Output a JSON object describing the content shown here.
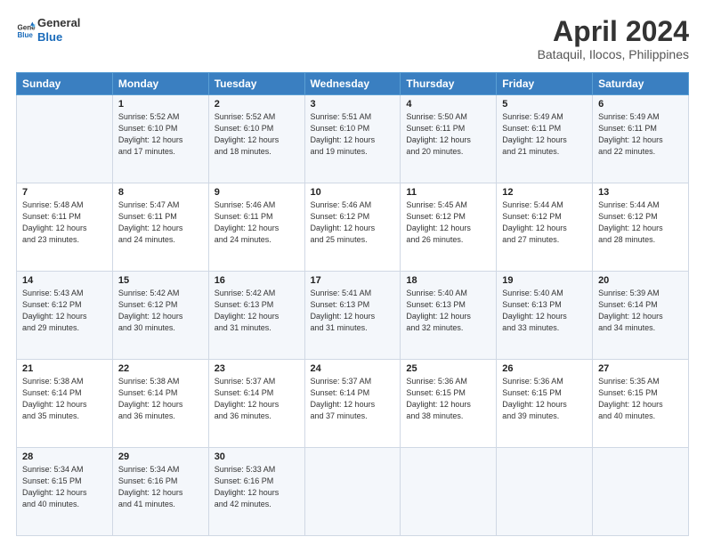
{
  "header": {
    "logo_line1": "General",
    "logo_line2": "Blue",
    "title": "April 2024",
    "subtitle": "Bataquil, Ilocos, Philippines"
  },
  "columns": [
    "Sunday",
    "Monday",
    "Tuesday",
    "Wednesday",
    "Thursday",
    "Friday",
    "Saturday"
  ],
  "rows": [
    [
      {
        "day": "",
        "info": ""
      },
      {
        "day": "1",
        "info": "Sunrise: 5:52 AM\nSunset: 6:10 PM\nDaylight: 12 hours\nand 17 minutes."
      },
      {
        "day": "2",
        "info": "Sunrise: 5:52 AM\nSunset: 6:10 PM\nDaylight: 12 hours\nand 18 minutes."
      },
      {
        "day": "3",
        "info": "Sunrise: 5:51 AM\nSunset: 6:10 PM\nDaylight: 12 hours\nand 19 minutes."
      },
      {
        "day": "4",
        "info": "Sunrise: 5:50 AM\nSunset: 6:11 PM\nDaylight: 12 hours\nand 20 minutes."
      },
      {
        "day": "5",
        "info": "Sunrise: 5:49 AM\nSunset: 6:11 PM\nDaylight: 12 hours\nand 21 minutes."
      },
      {
        "day": "6",
        "info": "Sunrise: 5:49 AM\nSunset: 6:11 PM\nDaylight: 12 hours\nand 22 minutes."
      }
    ],
    [
      {
        "day": "7",
        "info": "Sunrise: 5:48 AM\nSunset: 6:11 PM\nDaylight: 12 hours\nand 23 minutes."
      },
      {
        "day": "8",
        "info": "Sunrise: 5:47 AM\nSunset: 6:11 PM\nDaylight: 12 hours\nand 24 minutes."
      },
      {
        "day": "9",
        "info": "Sunrise: 5:46 AM\nSunset: 6:11 PM\nDaylight: 12 hours\nand 24 minutes."
      },
      {
        "day": "10",
        "info": "Sunrise: 5:46 AM\nSunset: 6:12 PM\nDaylight: 12 hours\nand 25 minutes."
      },
      {
        "day": "11",
        "info": "Sunrise: 5:45 AM\nSunset: 6:12 PM\nDaylight: 12 hours\nand 26 minutes."
      },
      {
        "day": "12",
        "info": "Sunrise: 5:44 AM\nSunset: 6:12 PM\nDaylight: 12 hours\nand 27 minutes."
      },
      {
        "day": "13",
        "info": "Sunrise: 5:44 AM\nSunset: 6:12 PM\nDaylight: 12 hours\nand 28 minutes."
      }
    ],
    [
      {
        "day": "14",
        "info": "Sunrise: 5:43 AM\nSunset: 6:12 PM\nDaylight: 12 hours\nand 29 minutes."
      },
      {
        "day": "15",
        "info": "Sunrise: 5:42 AM\nSunset: 6:12 PM\nDaylight: 12 hours\nand 30 minutes."
      },
      {
        "day": "16",
        "info": "Sunrise: 5:42 AM\nSunset: 6:13 PM\nDaylight: 12 hours\nand 31 minutes."
      },
      {
        "day": "17",
        "info": "Sunrise: 5:41 AM\nSunset: 6:13 PM\nDaylight: 12 hours\nand 31 minutes."
      },
      {
        "day": "18",
        "info": "Sunrise: 5:40 AM\nSunset: 6:13 PM\nDaylight: 12 hours\nand 32 minutes."
      },
      {
        "day": "19",
        "info": "Sunrise: 5:40 AM\nSunset: 6:13 PM\nDaylight: 12 hours\nand 33 minutes."
      },
      {
        "day": "20",
        "info": "Sunrise: 5:39 AM\nSunset: 6:14 PM\nDaylight: 12 hours\nand 34 minutes."
      }
    ],
    [
      {
        "day": "21",
        "info": "Sunrise: 5:38 AM\nSunset: 6:14 PM\nDaylight: 12 hours\nand 35 minutes."
      },
      {
        "day": "22",
        "info": "Sunrise: 5:38 AM\nSunset: 6:14 PM\nDaylight: 12 hours\nand 36 minutes."
      },
      {
        "day": "23",
        "info": "Sunrise: 5:37 AM\nSunset: 6:14 PM\nDaylight: 12 hours\nand 36 minutes."
      },
      {
        "day": "24",
        "info": "Sunrise: 5:37 AM\nSunset: 6:14 PM\nDaylight: 12 hours\nand 37 minutes."
      },
      {
        "day": "25",
        "info": "Sunrise: 5:36 AM\nSunset: 6:15 PM\nDaylight: 12 hours\nand 38 minutes."
      },
      {
        "day": "26",
        "info": "Sunrise: 5:36 AM\nSunset: 6:15 PM\nDaylight: 12 hours\nand 39 minutes."
      },
      {
        "day": "27",
        "info": "Sunrise: 5:35 AM\nSunset: 6:15 PM\nDaylight: 12 hours\nand 40 minutes."
      }
    ],
    [
      {
        "day": "28",
        "info": "Sunrise: 5:34 AM\nSunset: 6:15 PM\nDaylight: 12 hours\nand 40 minutes."
      },
      {
        "day": "29",
        "info": "Sunrise: 5:34 AM\nSunset: 6:16 PM\nDaylight: 12 hours\nand 41 minutes."
      },
      {
        "day": "30",
        "info": "Sunrise: 5:33 AM\nSunset: 6:16 PM\nDaylight: 12 hours\nand 42 minutes."
      },
      {
        "day": "",
        "info": ""
      },
      {
        "day": "",
        "info": ""
      },
      {
        "day": "",
        "info": ""
      },
      {
        "day": "",
        "info": ""
      }
    ]
  ]
}
